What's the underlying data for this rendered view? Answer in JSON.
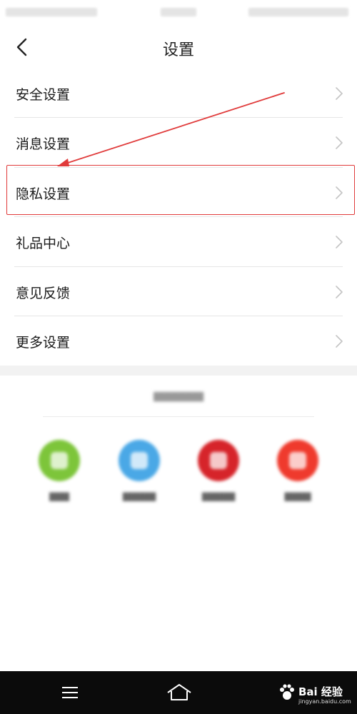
{
  "header": {
    "title": "设置"
  },
  "menu": {
    "items": [
      {
        "label": "安全设置"
      },
      {
        "label": "消息设置"
      },
      {
        "label": "隐私设置"
      },
      {
        "label": "礼品中心"
      },
      {
        "label": "意见反馈"
      },
      {
        "label": "更多设置"
      }
    ]
  },
  "colors": {
    "annotation_red": "#e03a3a",
    "share_colors": [
      "#7dc53a",
      "#4aa8e6",
      "#d6242a",
      "#ef3a2d"
    ]
  },
  "icons": {
    "back": "chevron-left-icon",
    "item_arrow": "chevron-right-icon",
    "nav_menu": "menu-icon",
    "nav_home": "home-icon"
  },
  "watermark": {
    "text": "Bai 经验",
    "sub": "jingyan.baidu.com"
  }
}
